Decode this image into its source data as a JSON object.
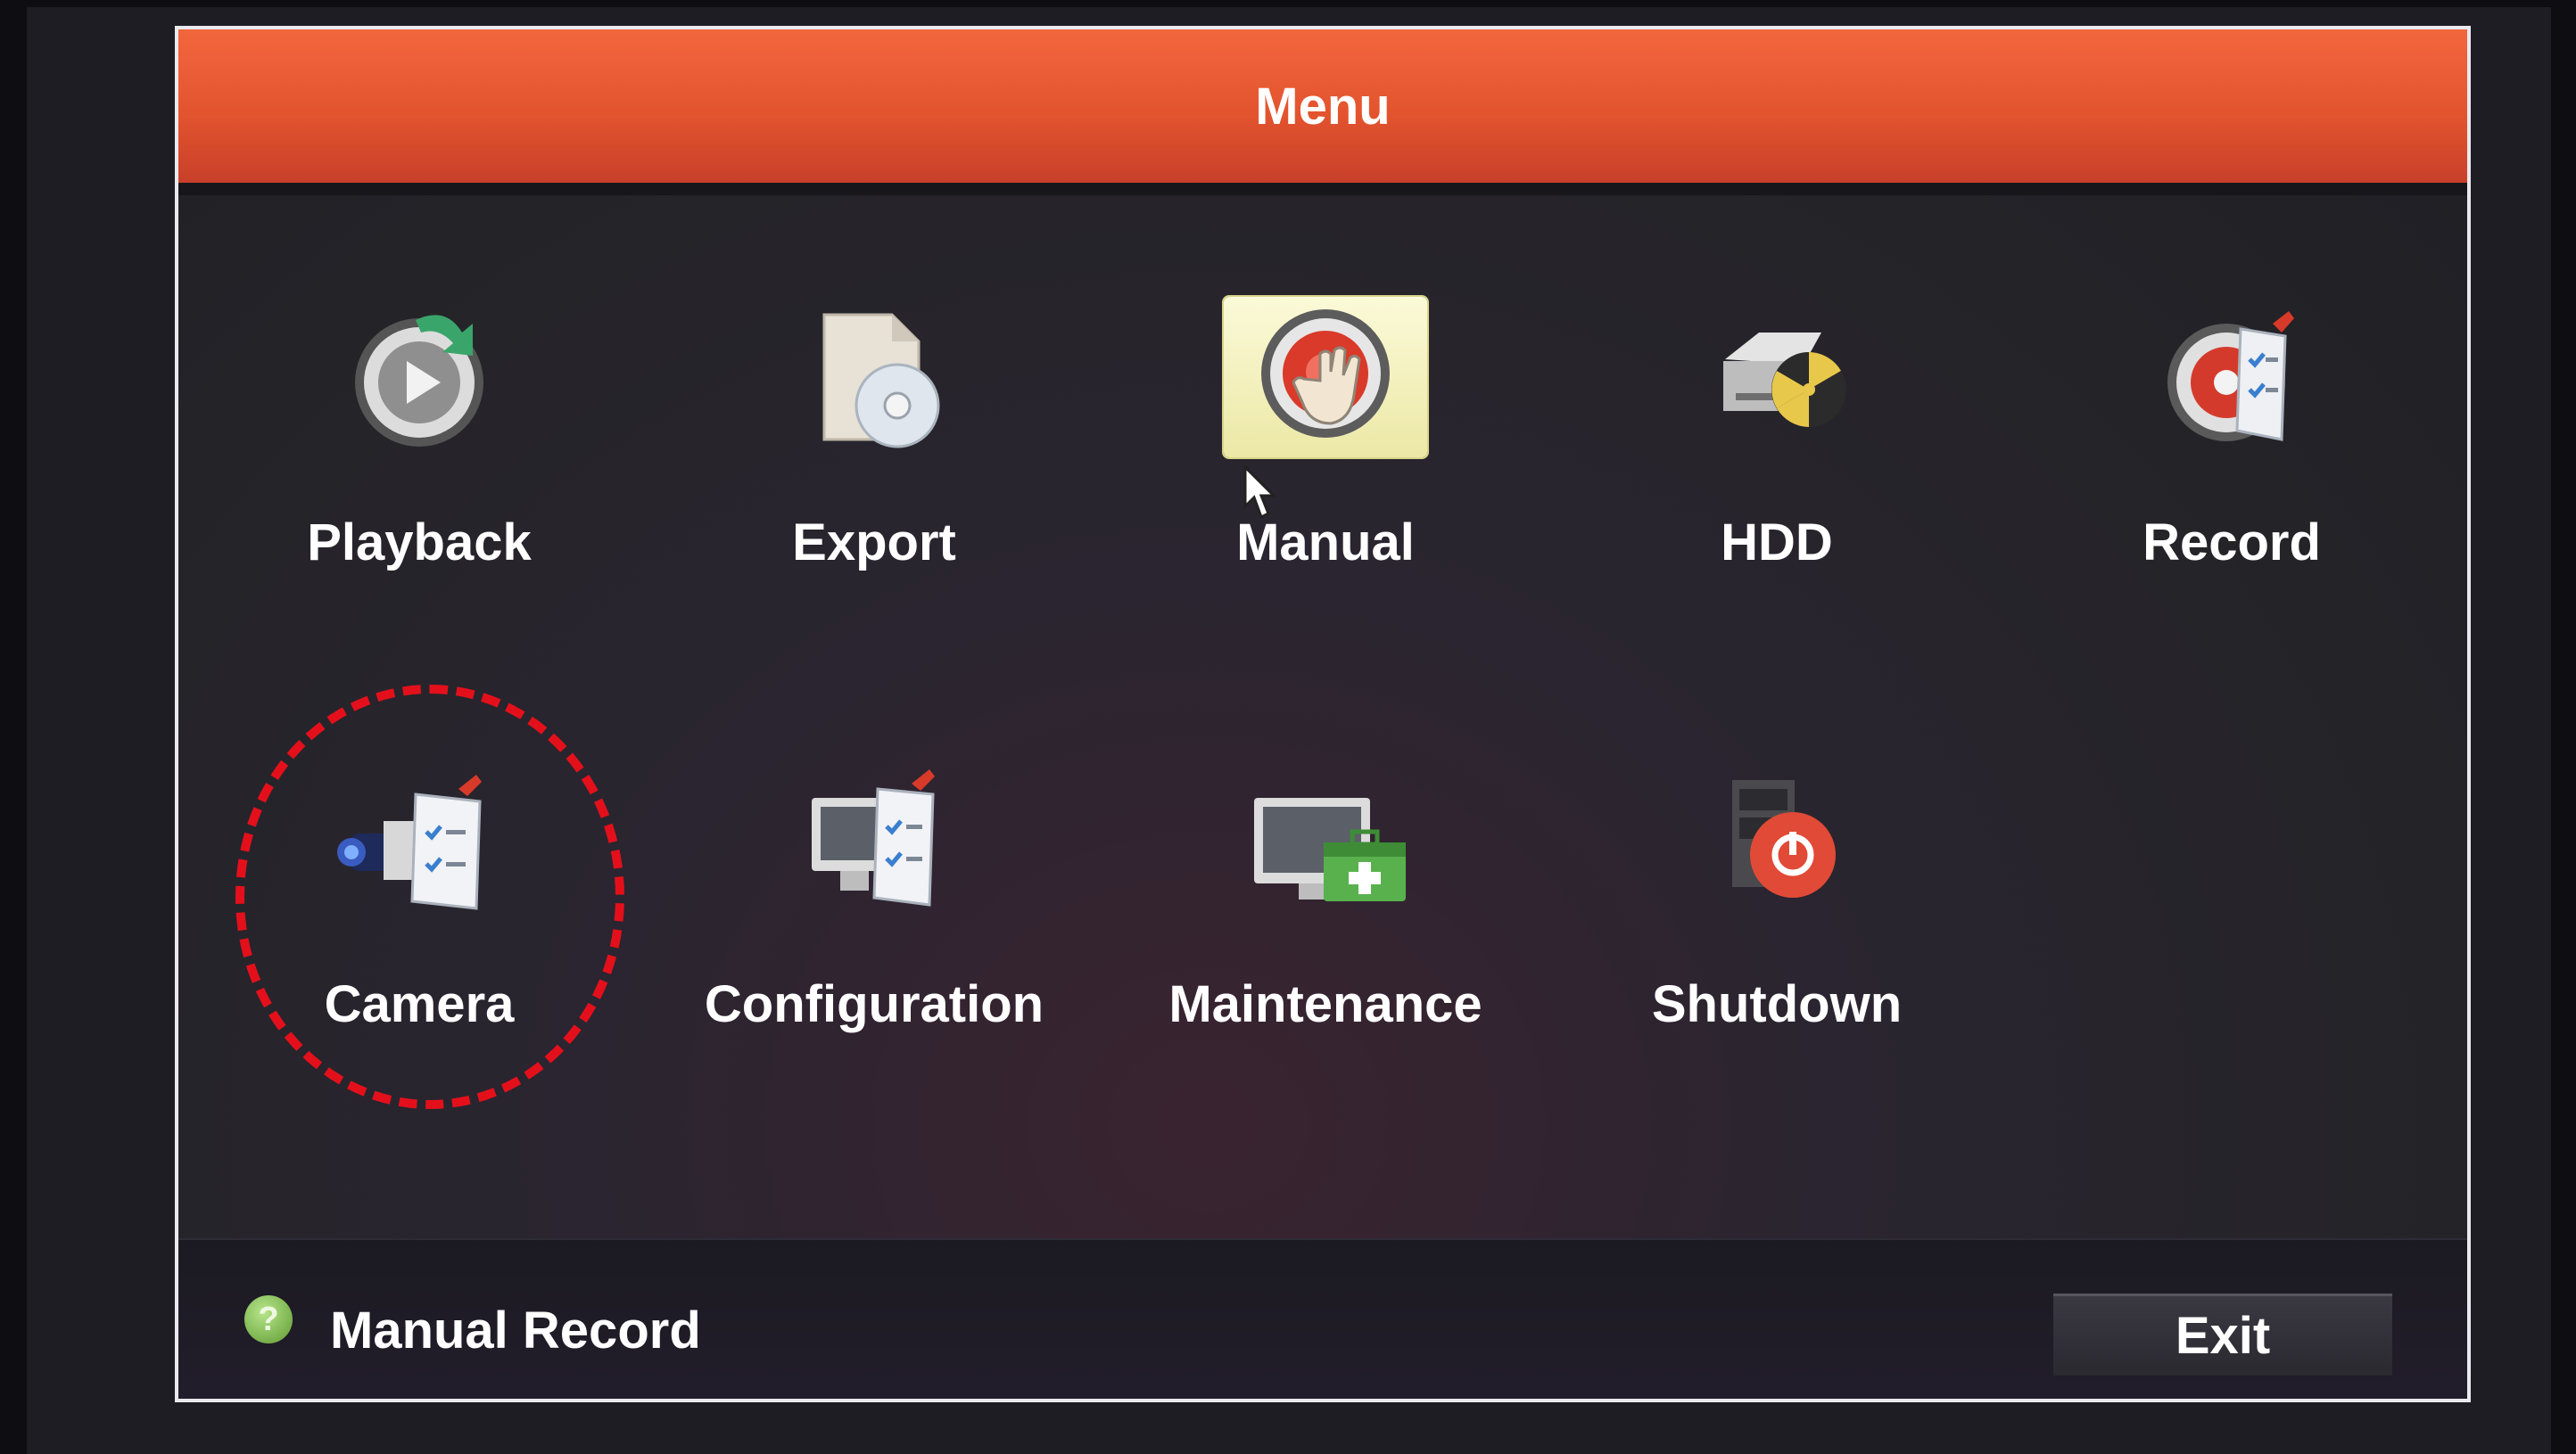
{
  "window": {
    "title": "Menu"
  },
  "menu_items": [
    {
      "label": "Playback",
      "icon": "playback-icon"
    },
    {
      "label": "Export",
      "icon": "export-icon"
    },
    {
      "label": "Manual",
      "icon": "manual-icon",
      "selected": true
    },
    {
      "label": "HDD",
      "icon": "hdd-icon"
    },
    {
      "label": "Record",
      "icon": "record-icon"
    },
    {
      "label": "Camera",
      "icon": "camera-icon"
    },
    {
      "label": "Configuration",
      "icon": "configuration-icon"
    },
    {
      "label": "Maintenance",
      "icon": "maintenance-icon"
    },
    {
      "label": "Shutdown",
      "icon": "shutdown-icon"
    }
  ],
  "footer": {
    "help_icon": "?",
    "hint": "Manual Record",
    "exit_label": "Exit"
  },
  "colors": {
    "title_bar": "#e3542e",
    "selection": "#f4f1be",
    "annotation": "#e3101b"
  }
}
